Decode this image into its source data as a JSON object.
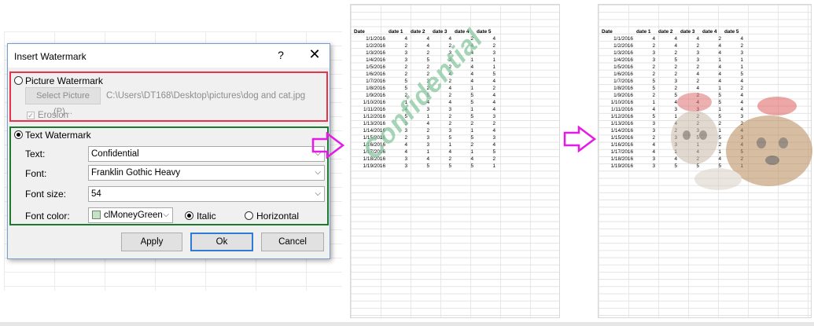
{
  "dialog": {
    "title": "Insert Watermark",
    "help": "?",
    "close": "✕",
    "picture_option": "Picture Watermark",
    "select_picture_button": "Select Picture (P)...",
    "picture_path": "C:\\Users\\DT168\\Desktop\\pictures\\dog and cat.jpg",
    "erosion_label": "Erosion",
    "text_option": "Text Watermark",
    "text_label": "Text:",
    "text_value": "Confidential",
    "font_label": "Font:",
    "font_value": "Franklin Gothic Heavy",
    "size_label": "Font size:",
    "size_value": "54",
    "color_label": "Font color:",
    "color_value": "clMoneyGreen",
    "italic_label": "Italic",
    "horizontal_label": "Horizontal",
    "apply": "Apply",
    "ok": "Ok",
    "cancel": "Cancel"
  },
  "sheet": {
    "headers": [
      "Date",
      "date 1",
      "date 2",
      "date 3",
      "date 4",
      "date 5"
    ],
    "rows": [
      [
        "1/1/2016",
        "4",
        "4",
        "4",
        "2",
        "4"
      ],
      [
        "1/2/2016",
        "2",
        "4",
        "2",
        "4",
        "2"
      ],
      [
        "1/3/2016",
        "3",
        "2",
        "3",
        "4",
        "3"
      ],
      [
        "1/4/2016",
        "3",
        "5",
        "3",
        "1",
        "1"
      ],
      [
        "1/5/2016",
        "2",
        "2",
        "2",
        "4",
        "1"
      ],
      [
        "1/6/2016",
        "2",
        "2",
        "4",
        "4",
        "5"
      ],
      [
        "1/7/2016",
        "5",
        "3",
        "2",
        "4",
        "4"
      ],
      [
        "1/8/2016",
        "5",
        "2",
        "4",
        "1",
        "2"
      ],
      [
        "1/9/2016",
        "2",
        "5",
        "2",
        "5",
        "4"
      ],
      [
        "1/10/2016",
        "1",
        "4",
        "4",
        "5",
        "4"
      ],
      [
        "1/11/2016",
        "4",
        "3",
        "3",
        "1",
        "4"
      ],
      [
        "1/12/2016",
        "5",
        "1",
        "2",
        "5",
        "3"
      ],
      [
        "1/13/2016",
        "3",
        "4",
        "2",
        "2",
        "2"
      ],
      [
        "1/14/2016",
        "3",
        "2",
        "3",
        "1",
        "4"
      ],
      [
        "1/15/2016",
        "2",
        "3",
        "5",
        "5",
        "3"
      ],
      [
        "1/16/2016",
        "4",
        "3",
        "1",
        "2",
        "4"
      ],
      [
        "1/17/2016",
        "4",
        "1",
        "4",
        "1",
        "5"
      ],
      [
        "1/18/2016",
        "3",
        "4",
        "2",
        "4",
        "2"
      ],
      [
        "1/19/2016",
        "3",
        "5",
        "5",
        "5",
        "1"
      ]
    ]
  },
  "watermark_preview_text": "Confidential",
  "colors": {
    "picture_frame": "#e8334a",
    "text_frame": "#1d7a2c",
    "arrow": "#e619e6",
    "watermark_green": "#88c7a0",
    "ok_border": "#2f7bd6"
  }
}
